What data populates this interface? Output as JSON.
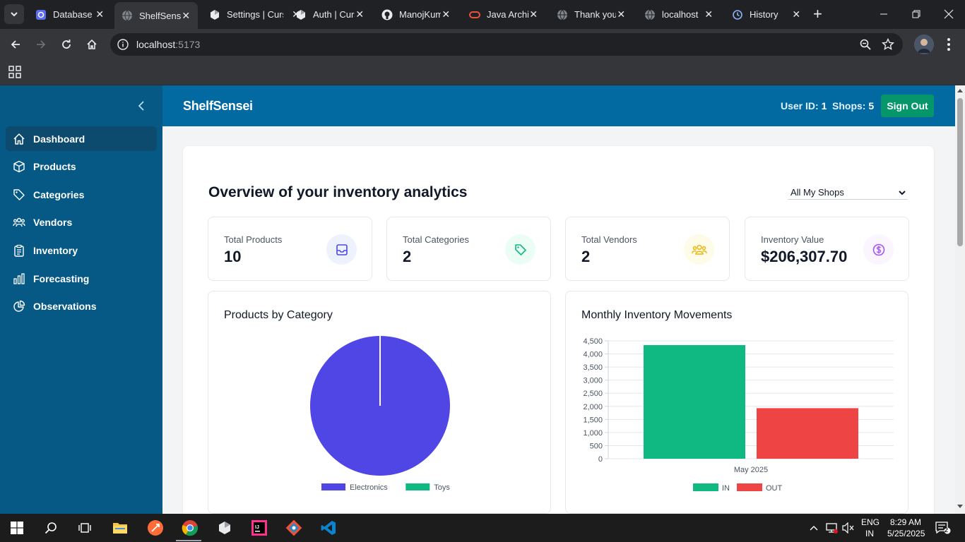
{
  "browser": {
    "tabs": [
      {
        "title": "Database",
        "icon": "database-favicon"
      },
      {
        "title": "ShelfSensei",
        "icon": "globe-favicon",
        "active": true
      },
      {
        "title": "Settings | Cursor",
        "icon": "cursor-favicon"
      },
      {
        "title": "Auth | Cursor",
        "icon": "cursor-favicon"
      },
      {
        "title": "ManojKumar",
        "icon": "github-favicon"
      },
      {
        "title": "Java Archive",
        "icon": "oracle-favicon"
      },
      {
        "title": "Thank you",
        "icon": "globe-favicon"
      },
      {
        "title": "localhost",
        "icon": "globe-favicon"
      },
      {
        "title": "History",
        "icon": "history-favicon"
      }
    ],
    "url_host": "localhost",
    "url_port": ":5173"
  },
  "app": {
    "brand": "ShelfSensei",
    "user_id_label": "User ID:",
    "user_id": "1",
    "shops_label": "Shops:",
    "shops": "5",
    "sign_out": "Sign Out"
  },
  "sidebar": {
    "items": [
      {
        "label": "Dashboard",
        "icon": "home-icon",
        "active": true
      },
      {
        "label": "Products",
        "icon": "cube-icon"
      },
      {
        "label": "Categories",
        "icon": "tag-icon"
      },
      {
        "label": "Vendors",
        "icon": "users-icon"
      },
      {
        "label": "Inventory",
        "icon": "clipboard-icon"
      },
      {
        "label": "Forecasting",
        "icon": "bar-chart-icon"
      },
      {
        "label": "Observations",
        "icon": "pie-chart-icon"
      }
    ]
  },
  "dashboard": {
    "heading": "Overview of your inventory analytics",
    "shop_filter": "All My Shops",
    "stats": [
      {
        "label": "Total Products",
        "value": "10",
        "icon": "inbox-icon",
        "color": "#4f46e5",
        "bg": "#eef2ff"
      },
      {
        "label": "Total Categories",
        "value": "2",
        "icon": "tag-icon",
        "color": "#10b981",
        "bg": "#ecfdf5"
      },
      {
        "label": "Total Vendors",
        "value": "2",
        "icon": "users-icon",
        "color": "#eab308",
        "bg": "#fefce8"
      },
      {
        "label": "Inventory Value",
        "value": "$206,307.70",
        "icon": "dollar-icon",
        "color": "#a855f7",
        "bg": "#faf5ff"
      }
    ]
  },
  "chart_data": [
    {
      "type": "pie",
      "title": "Products by Category",
      "categories": [
        "Electronics",
        "Toys"
      ],
      "values": [
        10,
        0
      ],
      "colors": [
        "#4f46e5",
        "#10b981"
      ],
      "legend": "bottom"
    },
    {
      "type": "bar",
      "title": "Monthly Inventory Movements",
      "categories": [
        "May 2025"
      ],
      "series": [
        {
          "name": "IN",
          "values": [
            4340
          ],
          "color": "#10b981"
        },
        {
          "name": "OUT",
          "values": [
            1930
          ],
          "color": "#ef4444"
        }
      ],
      "ylim": [
        0,
        4500
      ],
      "yticks": [
        "0",
        "500",
        "1,000",
        "1,500",
        "2,000",
        "2,500",
        "3,000",
        "3,500",
        "4,000",
        "4,500"
      ],
      "grid": true,
      "legend": "bottom"
    }
  ],
  "taskbar": {
    "lang": "ENG",
    "region": "IN",
    "time": "8:29 AM",
    "date": "5/25/2025",
    "notifications": "2"
  }
}
